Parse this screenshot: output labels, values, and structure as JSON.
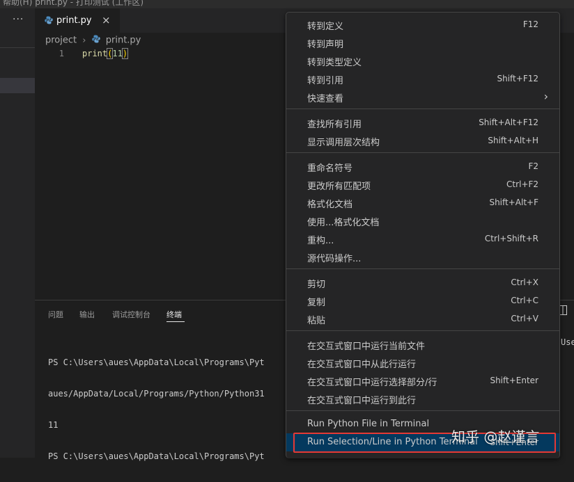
{
  "window": {
    "title_fragment": "帮助(H)          print.py - 打印测试 (工作区)"
  },
  "sidebar": {
    "more_label": "···"
  },
  "editor": {
    "tab_label": "print.py",
    "tab_close": "×",
    "breadcrumb": [
      "project",
      "print.py"
    ],
    "breadcrumb_sep": "›",
    "line_number": "1",
    "code_func": "print",
    "code_open": "(",
    "code_arg": "11",
    "code_close": ")"
  },
  "panel": {
    "tabs": [
      "问题",
      "输出",
      "调试控制台",
      "终端"
    ],
    "active_tab": "终端",
    "terminal_lines": [
      "PS C:\\Users\\aues\\AppData\\Local\\Programs\\Pyt",
      "aues/AppData/Local/Programs/Python/Python31",
      "11",
      "PS C:\\Users\\aues\\AppData\\Local\\Programs\\Pyt"
    ],
    "terminal_right_fragment": "Use"
  },
  "context_menu": {
    "groups": [
      [
        {
          "label": "转到定义",
          "shortcut": "F12"
        },
        {
          "label": "转到声明",
          "shortcut": ""
        },
        {
          "label": "转到类型定义",
          "shortcut": ""
        },
        {
          "label": "转到引用",
          "shortcut": "Shift+F12"
        },
        {
          "label": "快速查看",
          "shortcut": "",
          "submenu": true
        }
      ],
      [
        {
          "label": "查找所有引用",
          "shortcut": "Shift+Alt+F12"
        },
        {
          "label": "显示调用层次结构",
          "shortcut": "Shift+Alt+H"
        }
      ],
      [
        {
          "label": "重命名符号",
          "shortcut": "F2"
        },
        {
          "label": "更改所有匹配项",
          "shortcut": "Ctrl+F2"
        },
        {
          "label": "格式化文档",
          "shortcut": "Shift+Alt+F"
        },
        {
          "label": "使用...格式化文档",
          "shortcut": ""
        },
        {
          "label": "重构...",
          "shortcut": "Ctrl+Shift+R"
        },
        {
          "label": "源代码操作...",
          "shortcut": ""
        }
      ],
      [
        {
          "label": "剪切",
          "shortcut": "Ctrl+X"
        },
        {
          "label": "复制",
          "shortcut": "Ctrl+C"
        },
        {
          "label": "粘贴",
          "shortcut": "Ctrl+V"
        }
      ],
      [
        {
          "label": "在交互式窗口中运行当前文件",
          "shortcut": ""
        },
        {
          "label": "在交互式窗口中从此行运行",
          "shortcut": ""
        },
        {
          "label": "在交互式窗口中运行选择部分/行",
          "shortcut": "Shift+Enter"
        },
        {
          "label": "在交互式窗口中运行到此行",
          "shortcut": ""
        }
      ],
      [
        {
          "label": "Run Python File in Terminal",
          "shortcut": ""
        },
        {
          "label": "Run Selection/Line in Python Terminal",
          "shortcut": "Shift+Enter",
          "selected": true
        }
      ]
    ]
  },
  "watermark": "知乎 @赵谨言",
  "colors": {
    "menu_selected": "#04395e",
    "highlight_box": "#e53935",
    "python_icon": "#4b8bbe"
  }
}
